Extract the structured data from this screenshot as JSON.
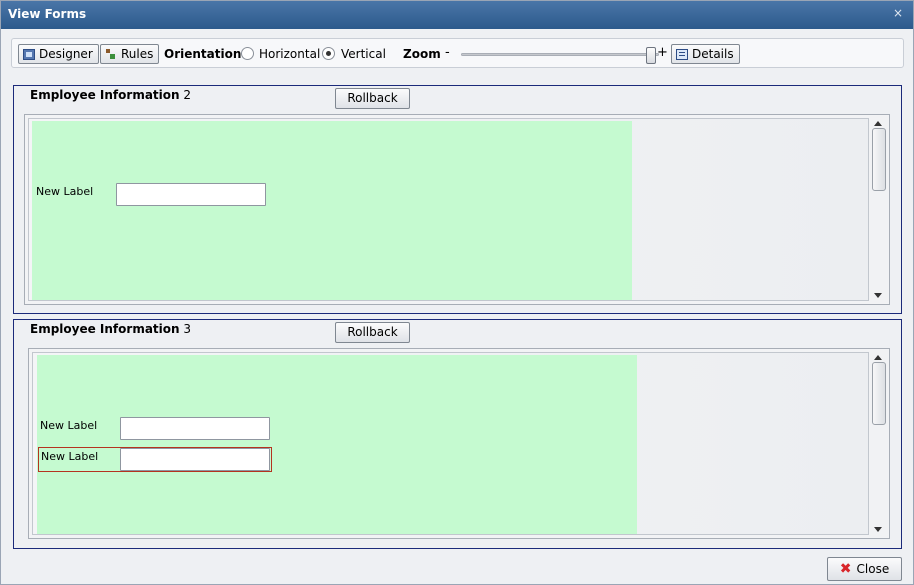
{
  "window": {
    "title": "View Forms",
    "close_glyph": "×"
  },
  "toolbar": {
    "designer_label": "Designer",
    "rules_label": "Rules",
    "orientation_label": "Orientation:",
    "orientation_options": [
      {
        "label": "Horizontal",
        "selected": false
      },
      {
        "label": "Vertical",
        "selected": true
      }
    ],
    "zoom_label": "Zoom",
    "zoom_minus": "-",
    "zoom_plus": "+",
    "zoom_level": 1.0,
    "details_label": "Details"
  },
  "panels": [
    {
      "title": "Employee Information",
      "number": "2",
      "rollback_label": "Rollback",
      "fields": [
        {
          "label": "New Label",
          "value": ""
        }
      ]
    },
    {
      "title": "Employee Information",
      "number": "3",
      "rollback_label": "Rollback",
      "fields": [
        {
          "label": "New Label",
          "value": ""
        },
        {
          "label": "New Label",
          "value": "",
          "selected": true
        }
      ]
    }
  ],
  "footer": {
    "close_label": "Close"
  },
  "colors": {
    "titlebar": "#2c5a8c",
    "canvas": "#c5fad0",
    "group_border": "#1b2a7a",
    "selection": "#b5321f",
    "close_icon": "#d8262b"
  },
  "icons": {
    "designer": "designer-icon",
    "rules": "rules-icon",
    "details": "details-icon",
    "close": "close-x-icon"
  }
}
